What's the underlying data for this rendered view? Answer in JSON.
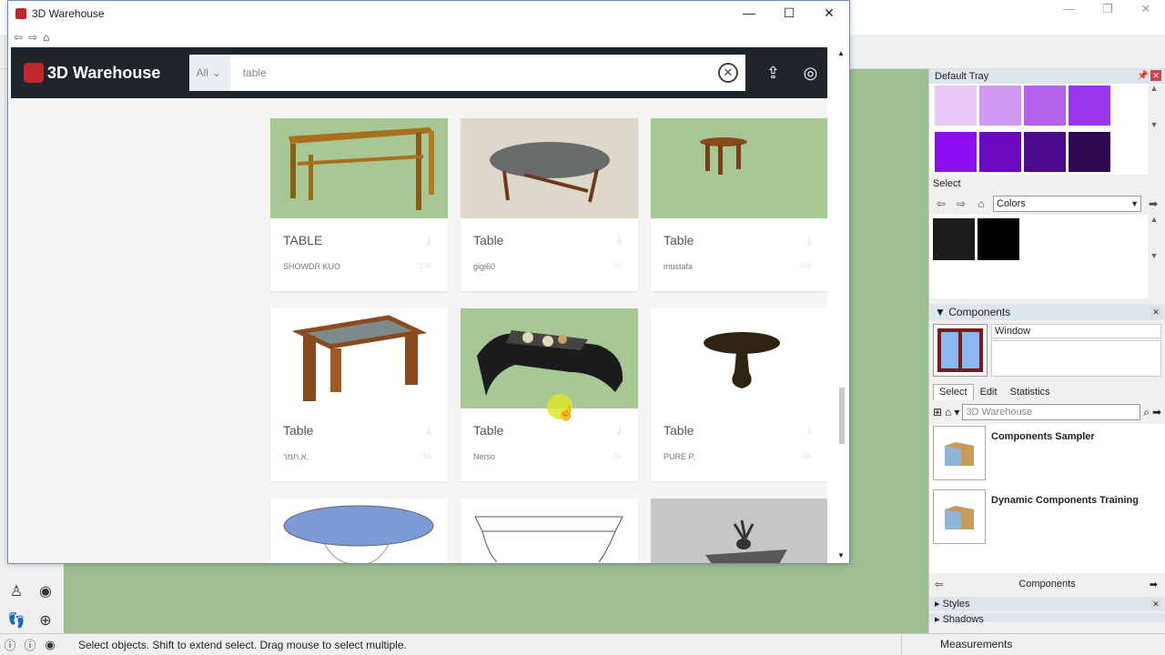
{
  "window": {
    "title": "3D Warehouse",
    "brand": "3D Warehouse",
    "filter": "All",
    "search_value": "table"
  },
  "results": [
    {
      "title": "TABLE",
      "author": "SHOWDR KUO",
      "count": "139"
    },
    {
      "title": "Table",
      "author": "gigi60",
      "count": "2K"
    },
    {
      "title": "Table",
      "author": "mustafa",
      "count": "298"
    },
    {
      "title": "Table",
      "author": "א.תמר.",
      "count": "788"
    },
    {
      "title": "Table",
      "author": "Nerso",
      "count": "1K"
    },
    {
      "title": "Table",
      "author": "PURE P.",
      "count": "1K"
    }
  ],
  "tray": {
    "title": "Default Tray",
    "select_label": "Select",
    "materials_combo": "Colors",
    "components_title": "Components",
    "component_name": "Window",
    "tabs": [
      "Select",
      "Edit",
      "Statistics"
    ],
    "search_placeholder": "3D Warehouse",
    "items": [
      "Components Sampler",
      "Dynamic Components Training"
    ],
    "footer": "Components",
    "styles": "Styles",
    "shadows": "Shadows",
    "swatch_colors": [
      "#e8c9f5",
      "#d19af0",
      "#b561ee",
      "#9c35f0",
      "#8d0ef0",
      "#6a09c0",
      "#4e0a8e",
      "#2e0a52"
    ],
    "material_colors": [
      "#1c1c1c",
      "#000000"
    ]
  },
  "status": {
    "hint": "Select objects. Shift to extend select. Drag mouse to select multiple.",
    "measurements": "Measurements"
  }
}
